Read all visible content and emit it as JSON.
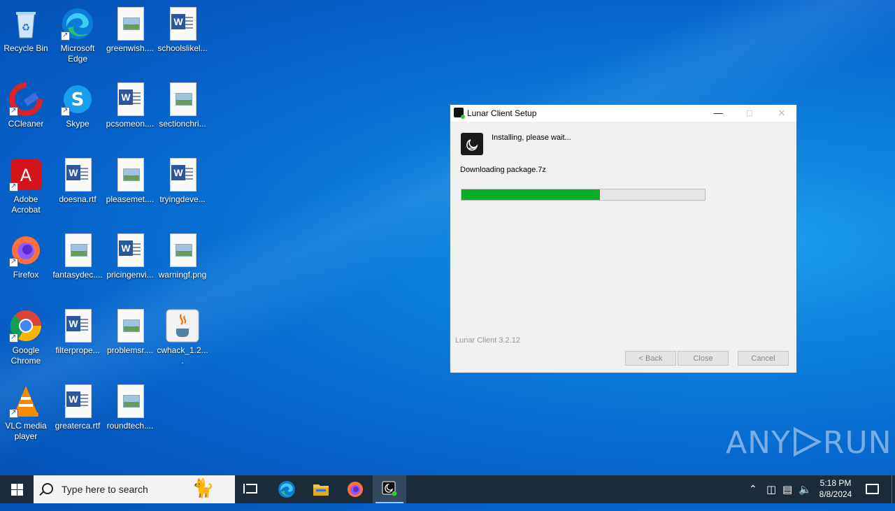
{
  "desktop": {
    "icons": [
      {
        "label": "Recycle Bin",
        "icon": "recycle-bin-icon"
      },
      {
        "label": "Microsoft Edge",
        "icon": "edge-icon"
      },
      {
        "label": "greenwish....",
        "icon": "image-file-icon"
      },
      {
        "label": "schoolslikel...",
        "icon": "word-doc-icon"
      },
      {
        "label": "CCleaner",
        "icon": "ccleaner-icon"
      },
      {
        "label": "Skype",
        "icon": "skype-icon"
      },
      {
        "label": "pcsomeon....",
        "icon": "word-doc-icon"
      },
      {
        "label": "sectionchri...",
        "icon": "image-file-icon"
      },
      {
        "label": "Adobe Acrobat",
        "icon": "acrobat-icon"
      },
      {
        "label": "doesna.rtf",
        "icon": "word-doc-icon"
      },
      {
        "label": "pleasemet....",
        "icon": "image-file-icon"
      },
      {
        "label": "tryingdeve...",
        "icon": "word-doc-icon"
      },
      {
        "label": "Firefox",
        "icon": "firefox-icon"
      },
      {
        "label": "fantasydec....",
        "icon": "image-file-icon"
      },
      {
        "label": "pricingenvi...",
        "icon": "word-doc-icon"
      },
      {
        "label": "warningf.png",
        "icon": "image-file-icon"
      },
      {
        "label": "Google Chrome",
        "icon": "chrome-icon"
      },
      {
        "label": "filterprope...",
        "icon": "word-doc-icon"
      },
      {
        "label": "problemsr....",
        "icon": "image-file-icon"
      },
      {
        "label": "cwhack_1.2....",
        "icon": "java-icon"
      },
      {
        "label": "VLC media player",
        "icon": "vlc-icon"
      },
      {
        "label": "greaterca.rtf",
        "icon": "word-doc-icon"
      },
      {
        "label": "roundtech....",
        "icon": "image-file-icon"
      }
    ]
  },
  "setup_window": {
    "title": "Lunar Client Setup",
    "status": "Installing, please wait...",
    "detail": "Downloading package.7z",
    "progress_fraction": 0.57,
    "version": "Lunar Client 3.2.12",
    "buttons": {
      "back": "< Back",
      "close": "Close",
      "cancel": "Cancel"
    },
    "colors": {
      "progress": "#06b025"
    }
  },
  "taskbar": {
    "search_placeholder": "Type here to search",
    "time": "5:18 PM",
    "date": "8/8/2024"
  },
  "watermark": {
    "text_left": "ANY",
    "text_right": "RUN"
  }
}
